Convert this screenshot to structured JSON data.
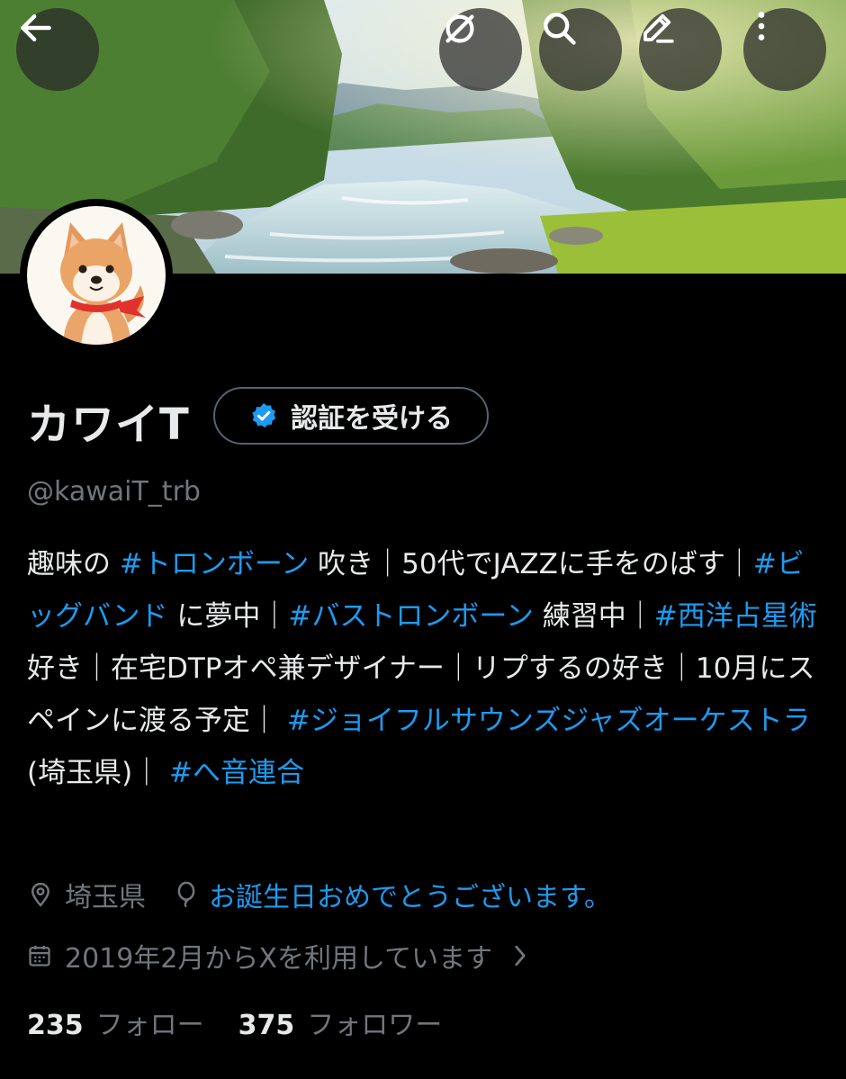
{
  "profile": {
    "display_name": "カワイT",
    "verify_label": "認証を受ける",
    "handle": "@kawaiT_trb"
  },
  "bio": {
    "segments": [
      {
        "text": "趣味の ",
        "tag": false
      },
      {
        "text": "#トロンボーン",
        "tag": true
      },
      {
        "text": " 吹き｜50代でJAZZに手をのばす｜",
        "tag": false
      },
      {
        "text": "#ビッグバンド",
        "tag": true
      },
      {
        "text": " に夢中｜",
        "tag": false
      },
      {
        "text": "#バストロンボーン",
        "tag": true
      },
      {
        "text": " 練習中｜",
        "tag": false
      },
      {
        "text": "#西洋占星術",
        "tag": true
      },
      {
        "text": " 好き｜在宅DTPオペ兼デザイナー｜リプするの好き｜10月にスペインに渡る予定｜ ",
        "tag": false
      },
      {
        "text": "#ジョイフルサウンズジャズオーケストラ",
        "tag": true
      },
      {
        "text": "(埼玉県)｜ ",
        "tag": false
      },
      {
        "text": "#へ音連合",
        "tag": true
      }
    ]
  },
  "meta": {
    "location": "埼玉県",
    "birthday": "お誕生日おめでとうございます。",
    "joined": "2019年2月からXを利用しています"
  },
  "stats": {
    "following_count": "235",
    "following_label": "フォロー",
    "followers_count": "375",
    "followers_label": "フォロワー"
  },
  "icons": {
    "back": "back-arrow-icon",
    "grok": "grok-icon",
    "search": "search-icon",
    "edit": "edit-icon",
    "more": "more-vertical-icon",
    "verified": "verified-badge-icon",
    "location": "location-pin-icon",
    "birthday": "balloon-icon",
    "calendar": "calendar-icon",
    "chevron": "chevron-right-icon"
  },
  "colors": {
    "accent": "#1d9bf0",
    "secondary_text": "#71767b",
    "primary_text": "#e7e9ea"
  }
}
